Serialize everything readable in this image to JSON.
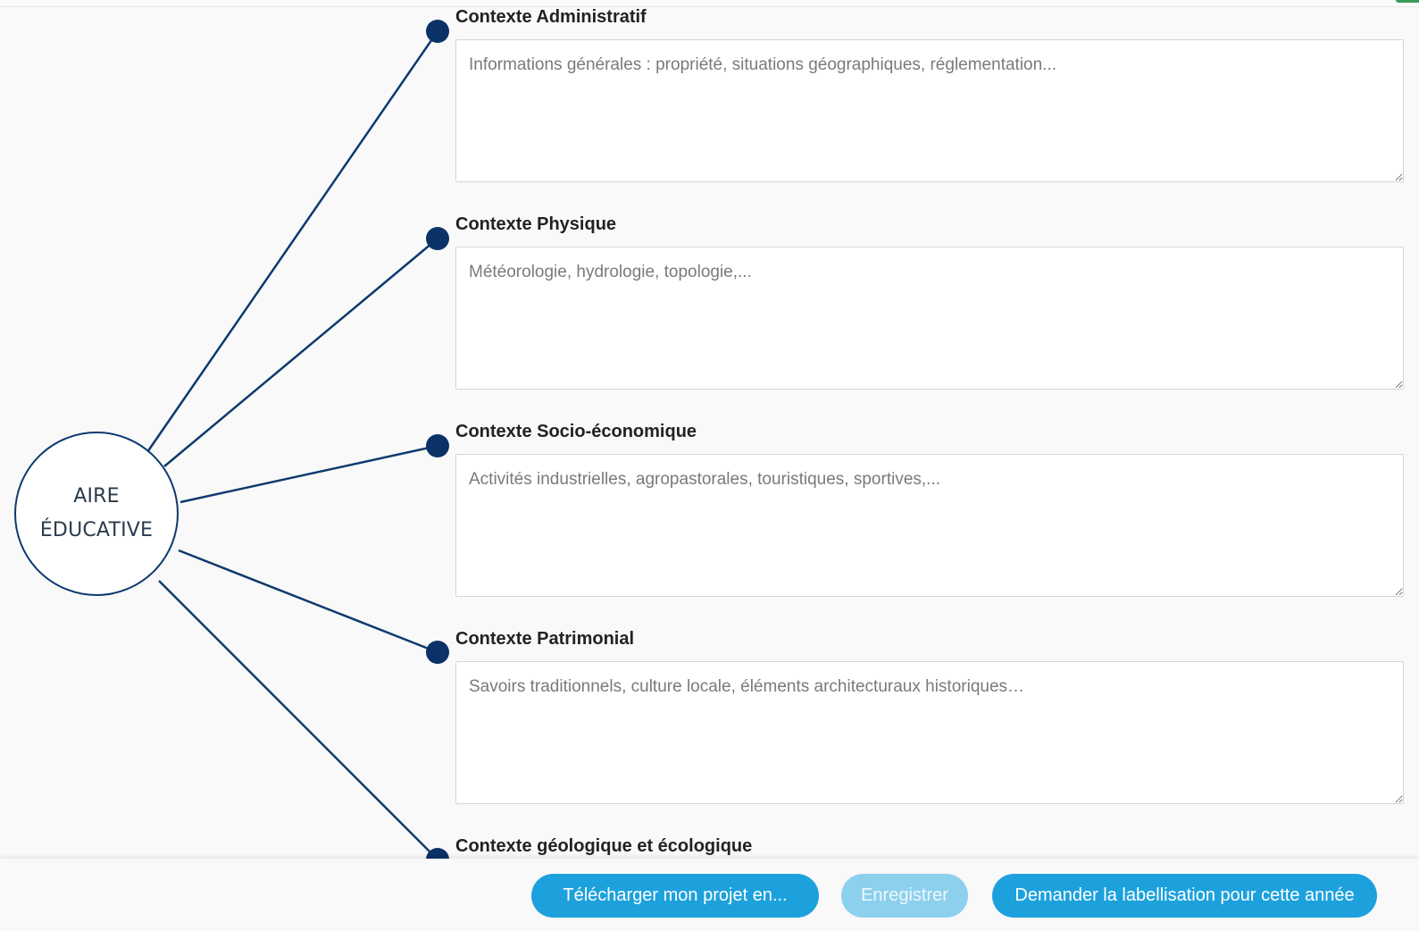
{
  "hub": {
    "line1": "AIRE",
    "line2": "ÉDUCATIVE"
  },
  "sections": [
    {
      "title": "Contexte Administratif",
      "placeholder": "Informations générales : propriété, situations géographiques, réglementation..."
    },
    {
      "title": "Contexte Physique",
      "placeholder": "Météorologie, hydrologie, topologie,..."
    },
    {
      "title": "Contexte Socio-économique",
      "placeholder": "Activités industrielles, agropastorales, touristiques, sportives,..."
    },
    {
      "title": "Contexte Patrimonial",
      "placeholder": "Savoirs traditionnels, culture locale, éléments architecturaux historiques…"
    },
    {
      "title": "Contexte géologique et écologique"
    }
  ],
  "footer": {
    "download_label": "Télécharger mon projet en...",
    "save_label": "Enregistrer",
    "request_label": "Demander la labellisation pour cette année"
  },
  "colors": {
    "line": "#0d3a6e",
    "node": "#0a3266",
    "button": "#1da1dc",
    "button_disabled": "#8dd0ee"
  },
  "icons": [
    "textarea-resize-handle-icon"
  ]
}
